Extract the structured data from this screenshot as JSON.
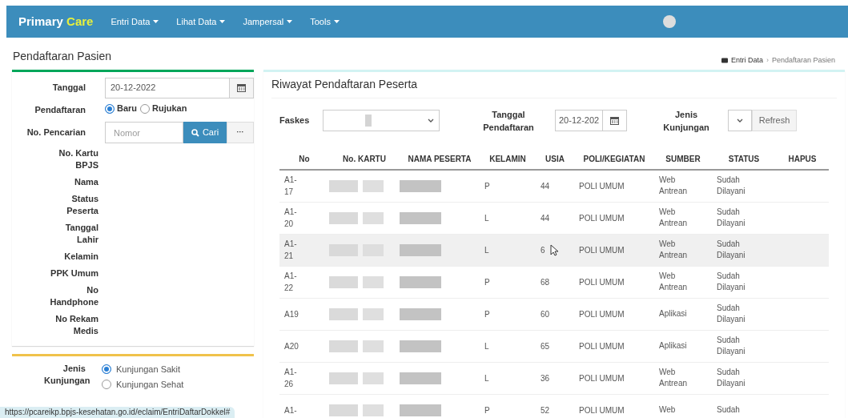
{
  "navbar": {
    "brand_first": "Primary",
    "brand_second": "Care",
    "menus": [
      {
        "label": "Entri Data"
      },
      {
        "label": "Lihat Data"
      },
      {
        "label": "Jampersal"
      },
      {
        "label": "Tools"
      }
    ]
  },
  "page_title": "Pendaftaran Pasien",
  "breadcrumb": [
    "Entri Data",
    "Pendaftaran Pasien"
  ],
  "breadcrumb_separator": "›",
  "form": {
    "tanggal_label": "Tanggal",
    "tanggal_value": "20-12-2022",
    "pendaftaran_label": "Pendaftaran",
    "pendaftaran_options": [
      {
        "label": "Baru",
        "selected": true
      },
      {
        "label": "Rujukan",
        "selected": false
      }
    ],
    "pencarian_label": "No. Pencarian",
    "pencarian_placeholder": "Nomor",
    "search_button": "Cari",
    "more_button": "···",
    "fields": [
      "No. Kartu BPJS",
      "Nama",
      "Status Peserta",
      "Tanggal Lahir",
      "Kelamin",
      "PPK Umum",
      "No Handphone",
      "No Rekam Medis"
    ],
    "jenis_label": "Jenis Kunjungan",
    "jenis_options": [
      {
        "label": "Kunjungan Sakit",
        "selected": true
      },
      {
        "label": "Kunjungan Sehat",
        "selected": false
      }
    ]
  },
  "history": {
    "title": "Riwayat Pendaftaran Peserta",
    "faskes_label": "Faskes",
    "tanggal_label": "Tanggal Pendaftaran",
    "tanggal_value": "20-12-202",
    "jenis_label": "Jenis Kunjungan",
    "refresh_button": "Refresh",
    "columns": [
      "No",
      "No. KARTU",
      "NAMA PESERTA",
      "KELAMIN",
      "USIA",
      "POLI/KEGIATAN",
      "SUMBER",
      "STATUS",
      "HAPUS"
    ],
    "rows": [
      {
        "no": "A1-17",
        "kelamin": "P",
        "usia": "44",
        "poli": "POLI UMUM",
        "sumber": "Web Antrean",
        "status": "Sudah Dilayani",
        "hovered": false
      },
      {
        "no": "A1-20",
        "kelamin": "L",
        "usia": "44",
        "poli": "POLI UMUM",
        "sumber": "Web Antrean",
        "status": "Sudah Dilayani",
        "hovered": false
      },
      {
        "no": "A1-21",
        "kelamin": "L",
        "usia": "6",
        "poli": "POLI UMUM",
        "sumber": "Web Antrean",
        "status": "Sudah Dilayani",
        "hovered": true
      },
      {
        "no": "A1-22",
        "kelamin": "P",
        "usia": "68",
        "poli": "POLI UMUM",
        "sumber": "Web Antrean",
        "status": "Sudah Dilayani",
        "hovered": false
      },
      {
        "no": "A19",
        "kelamin": "P",
        "usia": "60",
        "poli": "POLI UMUM",
        "sumber": "Aplikasi",
        "status": "Sudah Dilayani",
        "hovered": false
      },
      {
        "no": "A20",
        "kelamin": "L",
        "usia": "65",
        "poli": "POLI UMUM",
        "sumber": "Aplikasi",
        "status": "Sudah Dilayani",
        "hovered": false
      },
      {
        "no": "A1-26",
        "kelamin": "L",
        "usia": "36",
        "poli": "POLI UMUM",
        "sumber": "Web Antrean",
        "status": "Sudah Dilayani",
        "hovered": false
      },
      {
        "no": "A1-",
        "kelamin": "P",
        "usia": "52",
        "poli": "POLI UMUM",
        "sumber": "Web",
        "status": "Sudah",
        "hovered": false
      }
    ]
  },
  "status_url": "https://pcareikp.bpjs-kesehatan.go.id/eclaim/EntriDaftarDokkel#"
}
